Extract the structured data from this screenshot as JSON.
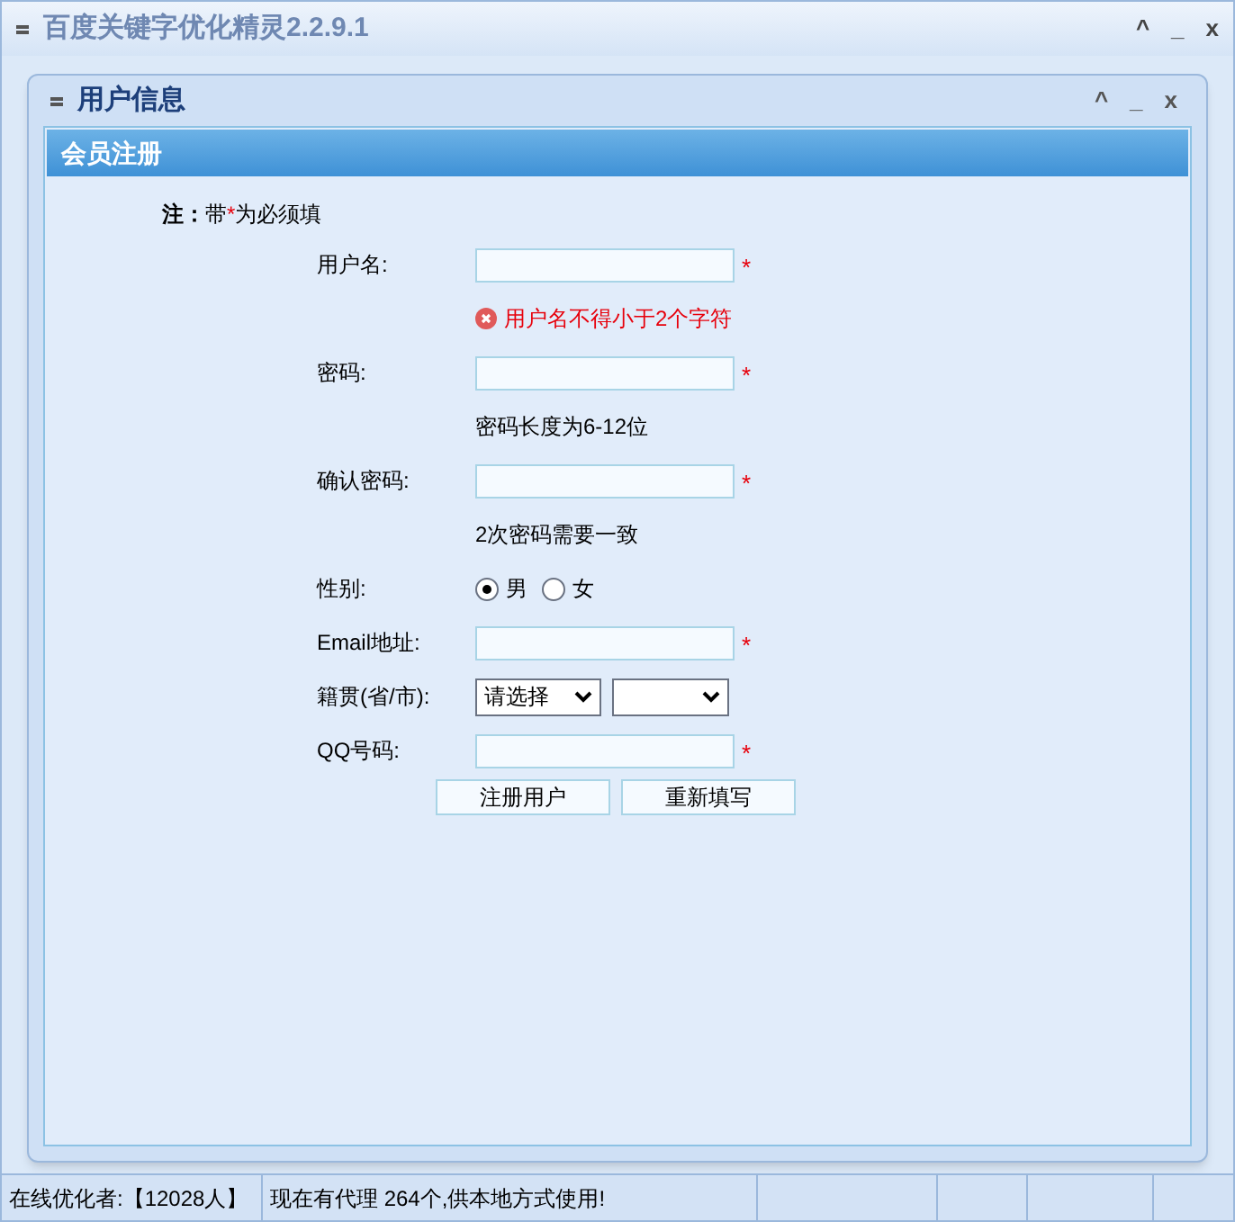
{
  "window": {
    "title": "百度关键字优化精灵2.2.9.1",
    "controls": [
      "^",
      "_",
      "x"
    ]
  },
  "dialog": {
    "title": "用户信息",
    "controls": [
      "^",
      "_",
      "x"
    ],
    "header": "会员注册",
    "note": {
      "label": "注：",
      "text": "带",
      "mark": "*",
      "rest": "为必须填"
    },
    "fields": [
      {
        "kind": "text",
        "label": "用户名:",
        "required": true,
        "error": "用户名不得小于2个字符"
      },
      {
        "kind": "text",
        "label": "密码:",
        "required": true,
        "hint": "密码长度为6-12位"
      },
      {
        "kind": "text",
        "label": "确认密码:",
        "required": true,
        "hint": "2次密码需要一致"
      },
      {
        "kind": "radio",
        "label": "性别:",
        "options": [
          {
            "label": "男",
            "selected": true
          },
          {
            "label": "女",
            "selected": false
          }
        ]
      },
      {
        "kind": "text",
        "label": "Email地址:",
        "required": true
      },
      {
        "kind": "select",
        "label": "籍贯(省/市):",
        "selects": [
          {
            "kind": "dropdown",
            "value": "请选择"
          },
          {
            "kind": "dropdown"
          }
        ]
      },
      {
        "kind": "text",
        "label": "QQ号码:",
        "required": true
      }
    ],
    "buttons": [
      "注册用户",
      "重新填写"
    ]
  },
  "status_bar": [
    "在线优化者:【12028人】",
    "现在有代理 264个,供本地方式使用!"
  ]
}
